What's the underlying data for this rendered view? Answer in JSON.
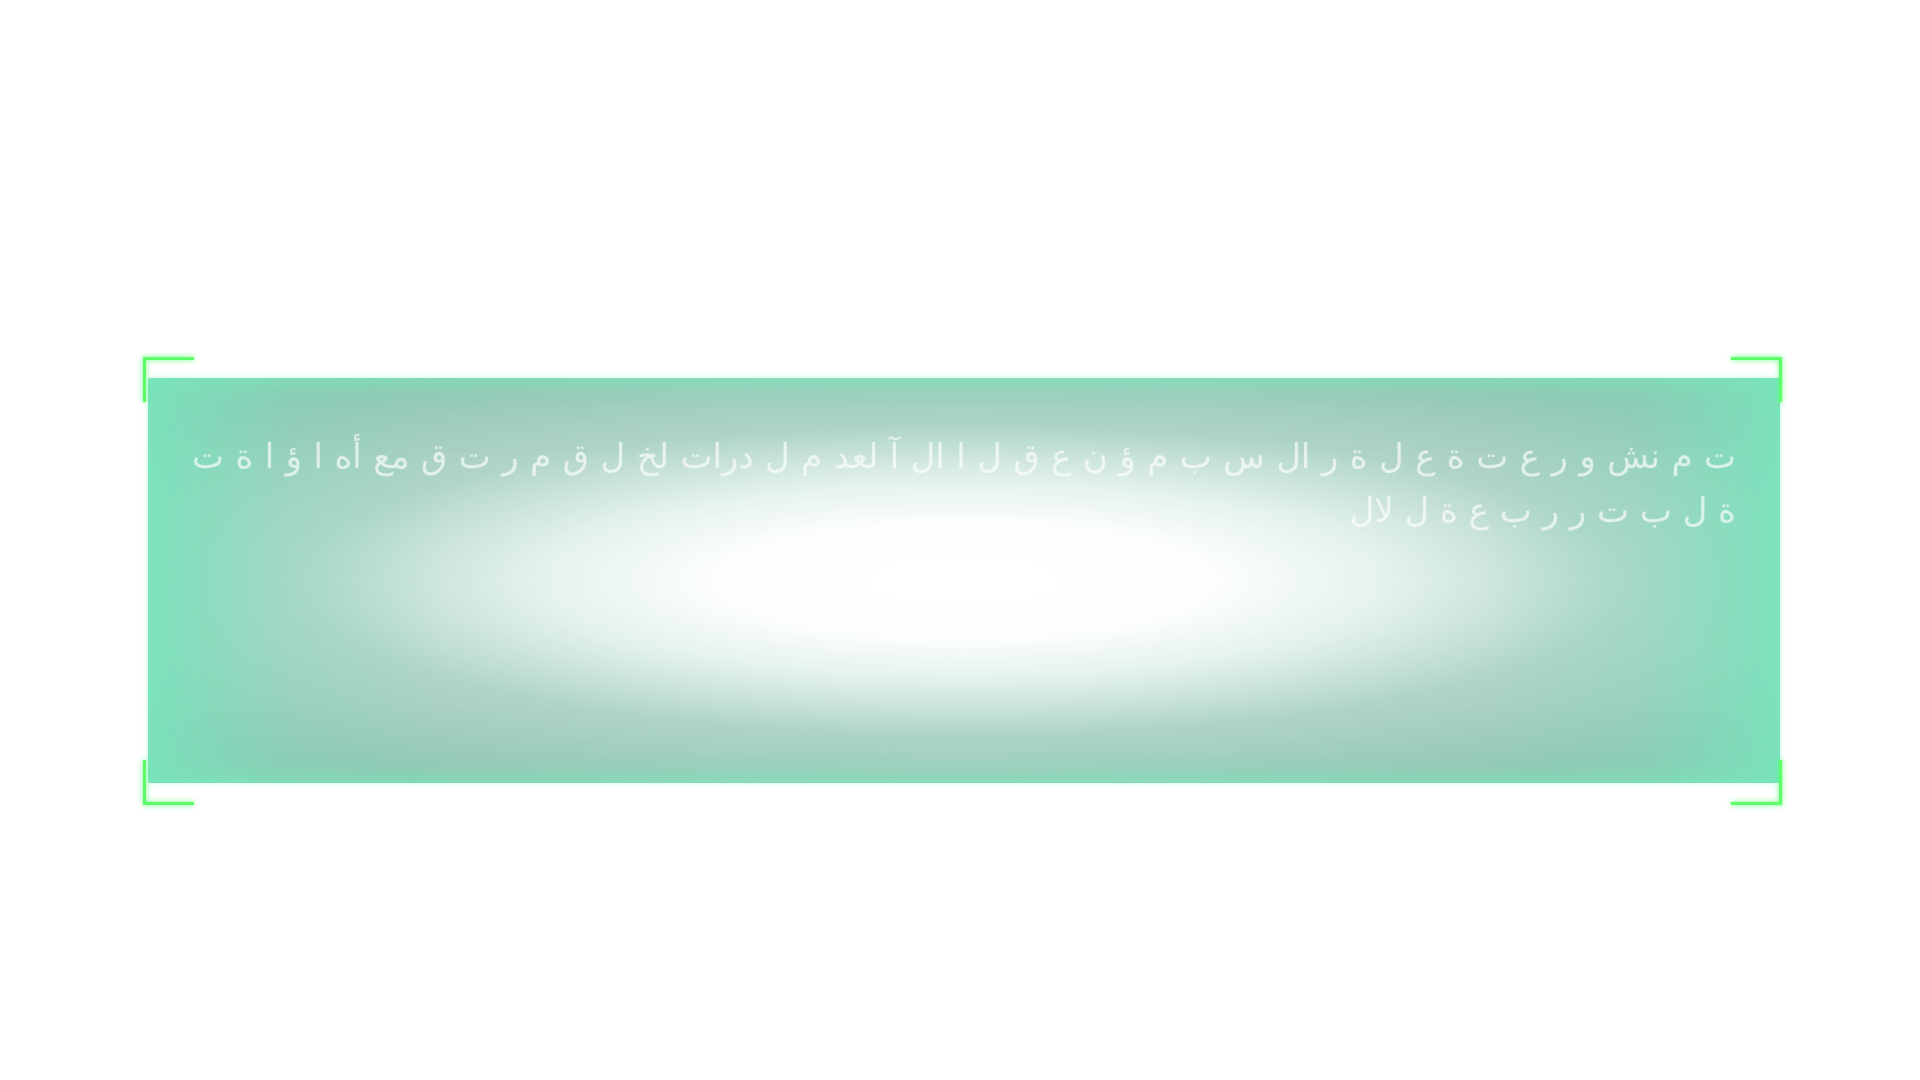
{
  "window": {
    "title": ""
  },
  "panel": {
    "content": "ت م نش و ر ع ت ة ع ل ة ر ال س ب م ؤ ن ع ق ل ا ال آ لعد م ل درات لخ ل ق م ر ت ق مع أه ا ؤ ا ة ت ة ل ب ت ر ر ب ع ة ل لال"
  },
  "icons": {
    "top_left": "corner-bracket-top-left-icon",
    "top_right": "corner-bracket-top-right-icon",
    "bottom_left": "corner-bracket-bottom-left-icon",
    "bottom_right": "corner-bracket-bottom-right-icon"
  },
  "colors": {
    "panel_base": "#8ed8bd",
    "panel_center": "#ffffff",
    "glow": "#5dff67",
    "text": "#ffffff"
  }
}
